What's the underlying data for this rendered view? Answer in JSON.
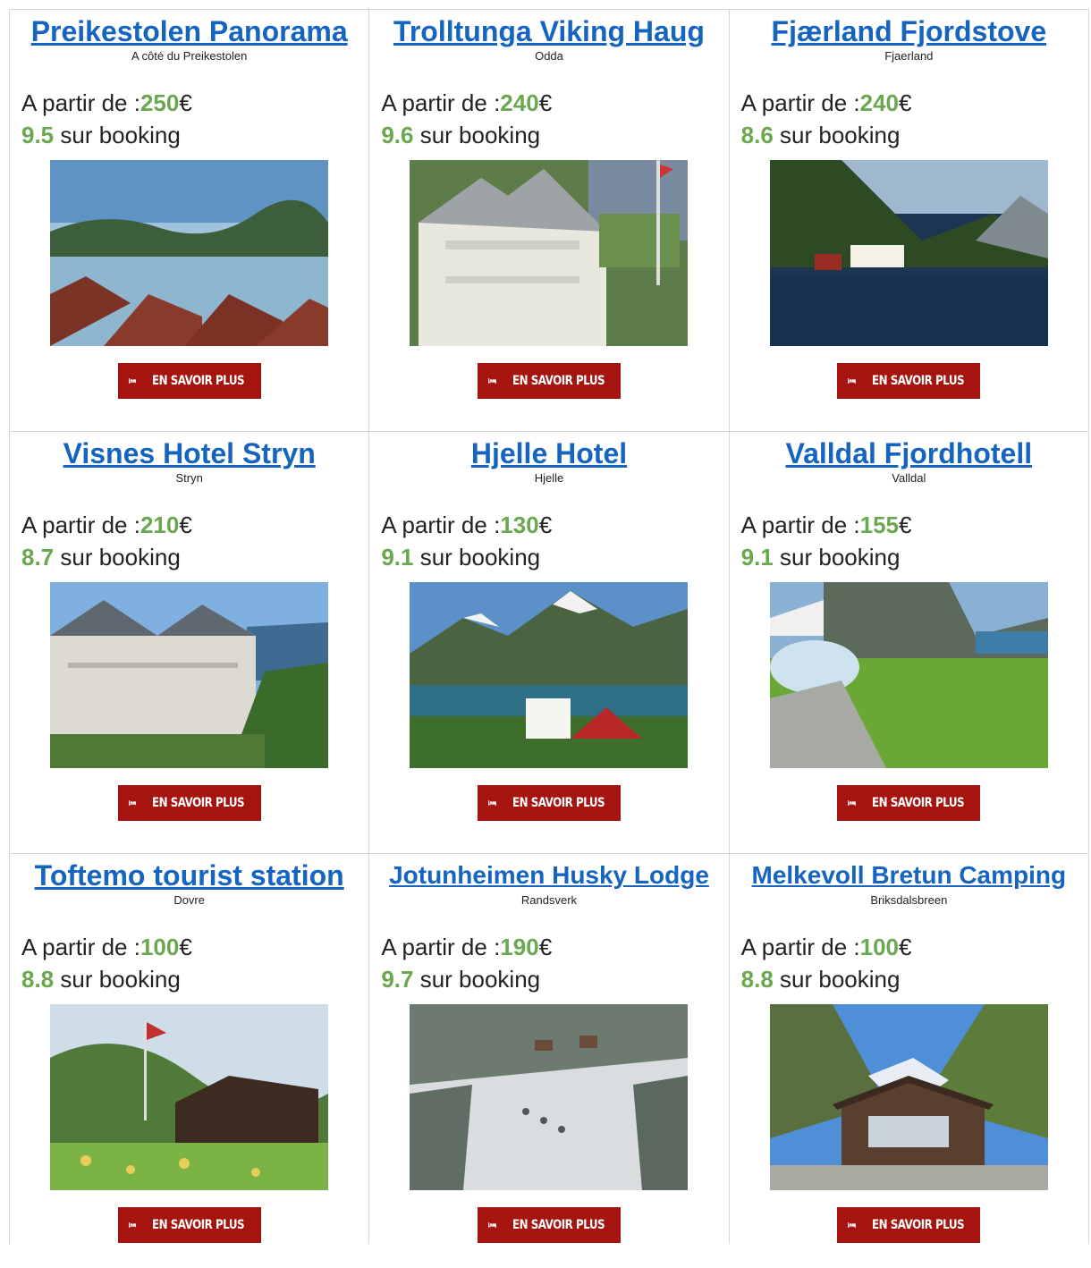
{
  "common": {
    "price_prefix": "A partir de :",
    "currency": "€",
    "rating_suffix": " sur booking",
    "button_label": "EN SAVOIR PLUS"
  },
  "hotels": [
    {
      "name": "Preikestolen Panorama",
      "location": "A côté du Preikestolen",
      "price": "250",
      "rating": "9.5"
    },
    {
      "name": "Trolltunga Viking Haug",
      "location": "Odda",
      "price": "240",
      "rating": "9.6"
    },
    {
      "name": "Fjærland Fjordstove",
      "location": "Fjaerland",
      "price": "240",
      "rating": "8.6"
    },
    {
      "name": "Visnes Hotel Stryn",
      "location": "Stryn",
      "price": "210",
      "rating": "8.7"
    },
    {
      "name": "Hjelle Hotel",
      "location": "Hjelle",
      "price": "130",
      "rating": "9.1"
    },
    {
      "name": "Valldal Fjordhotell",
      "location": "Valldal",
      "price": "155",
      "rating": "9.1"
    },
    {
      "name": "Toftemo tourist station",
      "location": "Dovre",
      "price": "100",
      "rating": "8.8"
    },
    {
      "name": "Jotunheimen Husky Lodge",
      "location": "Randsverk",
      "price": "190",
      "rating": "9.7"
    },
    {
      "name": "Melkevoll Bretun Camping",
      "location": "Briksdalsbreen",
      "price": "100",
      "rating": "8.8"
    }
  ],
  "colors": {
    "link": "#1565c0",
    "highlight": "#6aa84f",
    "button": "#a5140e",
    "border": "#d6d6d6"
  },
  "icons": {
    "button_icon": "bed-icon"
  }
}
